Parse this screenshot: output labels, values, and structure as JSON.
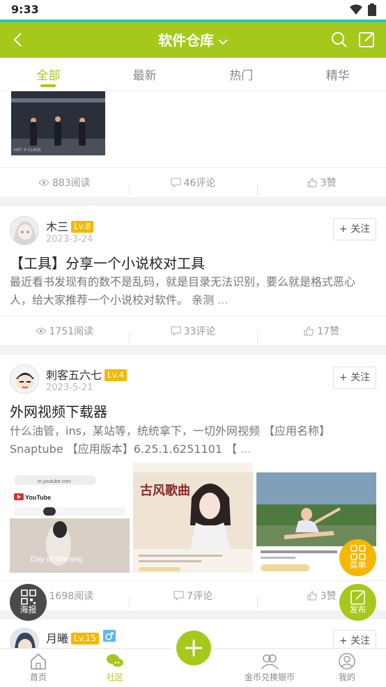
{
  "status_bar": {
    "time": "9:33"
  },
  "header": {
    "title": "软件仓库"
  },
  "tabs": [
    {
      "label": "全部",
      "active": true
    },
    {
      "label": "最新",
      "active": false
    },
    {
      "label": "热门",
      "active": false
    },
    {
      "label": "精华",
      "active": false
    }
  ],
  "posts": [
    {
      "stats": {
        "views": "883阅读",
        "comments": "46评论",
        "likes": "3赞"
      }
    },
    {
      "author": "木三",
      "level": "Lv.8",
      "date": "2023-3-24",
      "follow_label": "+ 关注",
      "title": "【工具】分享一个小说校对工具",
      "body": "最近看书发现有的数不是乱码，就是目录无法识别，要么就是格式恶心人，给大家推荐一个小说校对软件。 亲测",
      "ellipsis": "...",
      "stats": {
        "views": "1751阅读",
        "comments": "33评论",
        "likes": "17赞"
      }
    },
    {
      "author": "刺客五六七",
      "level": "Lv.4",
      "date": "2023-5-21",
      "follow_label": "+ 关注",
      "title": "外网视频下载器",
      "body": "什么油管，ins，某站等，统统拿下，一切外网视频 【应用名称】 Snaptube 【应用版本】6.25.1.6251101 【",
      "ellipsis": "...",
      "stats": {
        "views": "1698阅读",
        "comments": "7评论",
        "likes": "3赞"
      }
    },
    {
      "author": "月曦",
      "level": "Lv.15",
      "follow_label": "+ 关注"
    }
  ],
  "thumb_caption": "HIIT 4 CLASS",
  "shots": {
    "youtube_logo": "YouTube",
    "youtube_url": "m.youtube.com",
    "poster_title": "古风歌曲",
    "watermark": "Day of Morning"
  },
  "floating": {
    "menu": "菜单",
    "publish": "发布",
    "poster": "海报"
  },
  "bottom_nav": [
    {
      "label": "首页",
      "active": false
    },
    {
      "label": "社区",
      "active": true
    },
    {
      "label": "金币兑换银币",
      "active": false
    },
    {
      "label": "我的",
      "active": false
    }
  ],
  "colors": {
    "brand": "#a6c81b",
    "accent_line": "#1ec9c0",
    "level_badge": "#f5b700",
    "fab_orange": "#f5b700"
  }
}
